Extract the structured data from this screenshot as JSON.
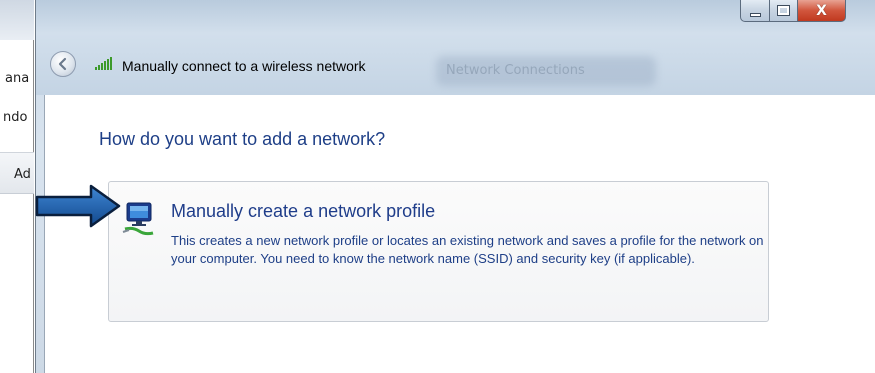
{
  "background_window": {
    "fragments": [
      "ana",
      "ndo",
      "Ad"
    ]
  },
  "dialog": {
    "title": "Manually connect to a wireless network",
    "ghost_title": "Network Connections",
    "caption": {
      "minimize_icon": "minimize-icon",
      "maximize_icon": "maximize-icon",
      "close_symbol": "X"
    },
    "heading": "How do you want to add a network?",
    "option": {
      "title": "Manually create a network profile",
      "description": "This creates a new network profile or locates an existing network and saves a profile for the network on your computer. You need to know the network name (SSID) and security key (if applicable).",
      "icon": "network-computer-icon"
    }
  },
  "annotation": {
    "arrow_color": "#1f5fa8",
    "icon": "arrow-right-icon"
  },
  "colors": {
    "heading": "#1e3f87",
    "link": "#1f3d8a",
    "close_button": "#c0391f"
  }
}
